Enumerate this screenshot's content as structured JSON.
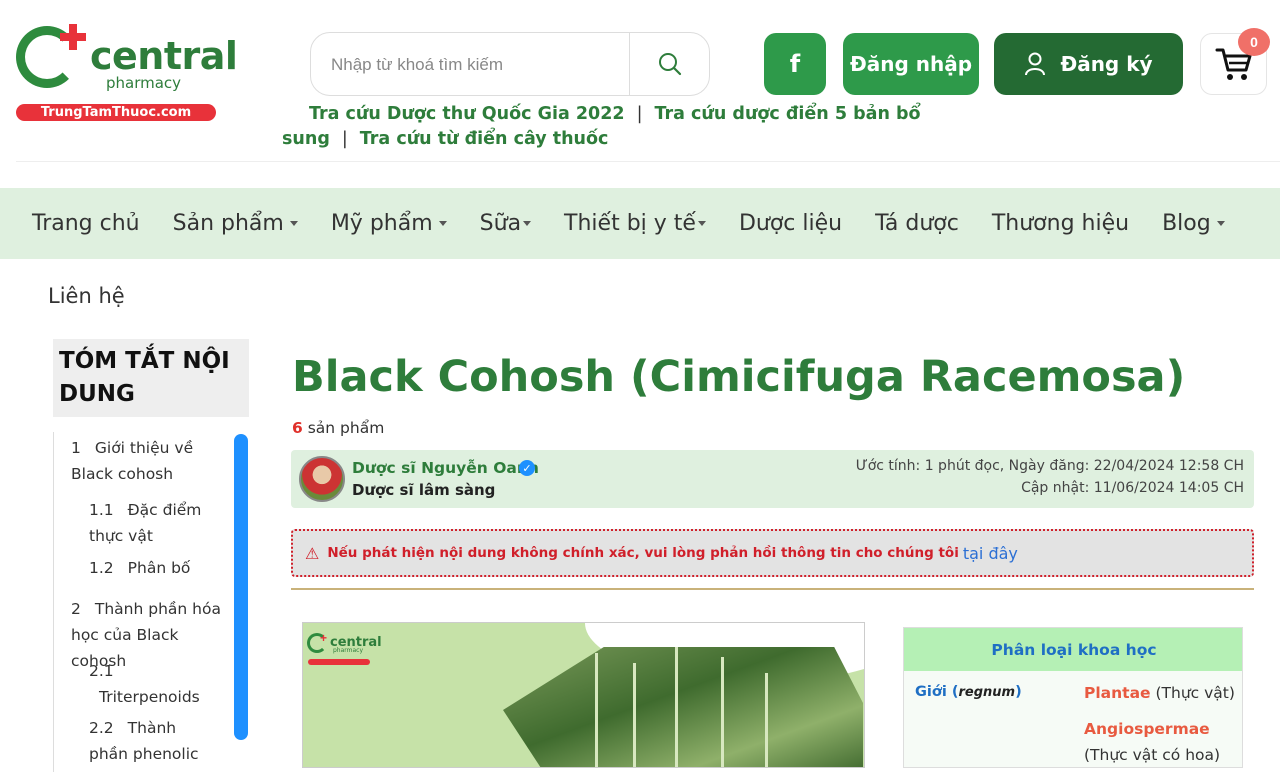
{
  "header": {
    "logo": {
      "brand": "central",
      "sub": "pharmacy",
      "domain": "TrungTamThuoc.com"
    },
    "search": {
      "placeholder": "Nhập từ khoá tìm kiếm"
    },
    "facebook_label": "f",
    "login_label": "Đăng nhập",
    "register_label": "Đăng ký",
    "cart_count": "0",
    "quicklinks": [
      "Tra cứu Dược thư Quốc Gia 2022",
      "Tra cứu dược điển 5 bản bổ sung",
      "Tra cứu từ điển cây thuốc"
    ],
    "separator": "|"
  },
  "nav": {
    "items": [
      {
        "label": "Trang chủ",
        "dropdown": false
      },
      {
        "label": "Sản phẩm",
        "dropdown": true
      },
      {
        "label": "Mỹ phẩm",
        "dropdown": true
      },
      {
        "label": "Sữa",
        "dropdown": true
      },
      {
        "label": "Thiết bị y tế",
        "dropdown": true
      },
      {
        "label": "Dược liệu",
        "dropdown": false
      },
      {
        "label": "Tá dược",
        "dropdown": false
      },
      {
        "label": "Thương hiệu",
        "dropdown": false
      },
      {
        "label": "Blog",
        "dropdown": true
      }
    ],
    "contact": "Liên hệ"
  },
  "toc": {
    "title": "TÓM TẮT NỘI DUNG",
    "items": [
      {
        "num": "1",
        "label": "Giới thiệu về Black cohosh"
      },
      {
        "num": "1.1",
        "label": "Đặc điểm thực vật"
      },
      {
        "num": "1.2",
        "label": "Phân bố"
      },
      {
        "num": "2",
        "label": "Thành phần hóa học của Black cohosh"
      },
      {
        "num": "2.1",
        "label": "Triterpenoids"
      },
      {
        "num": "2.2",
        "label": "Thành phần phenolic"
      }
    ]
  },
  "article": {
    "title": "Black Cohosh (Cimicifuga Racemosa)",
    "product_count": "6",
    "product_count_suffix": "sản phẩm",
    "author": {
      "name": "Dược sĩ Nguyễn Oanh",
      "role": "Dược sĩ lâm sàng",
      "meta_read": "Ước tính: 1 phút đọc, Ngày đăng: 22/04/2024 12:58 CH",
      "meta_updated": "Cập nhật: 11/06/2024 14:05 CH"
    },
    "warning": {
      "text": "Nếu phát hiện nội dung không chính xác, vui lòng phản hồi thông tin cho chúng tôi",
      "link": "tại đây"
    }
  },
  "image_logo": {
    "brand": "central",
    "sub": "pharmacy"
  },
  "taxonomy": {
    "header": "Phân loại khoa học",
    "rank": "Giới",
    "rank_latin": "regnum",
    "values": [
      {
        "latin": "Plantae",
        "vn": "(Thực vật)"
      },
      {
        "latin": "Angiospermae",
        "vn": "(Thực vật có hoa)"
      }
    ]
  },
  "colors": {
    "brand_green": "#2e7d3b",
    "button_green": "#2e9a4a",
    "dark_green": "#246a33",
    "nav_bg": "#dff0df",
    "accent_red": "#e8323a",
    "link_blue": "#1f6fc4"
  }
}
